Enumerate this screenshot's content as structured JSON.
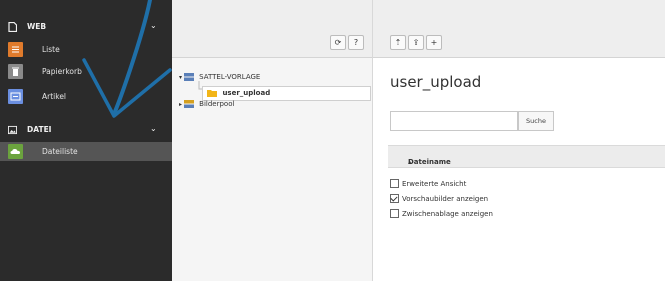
{
  "sidebar": {
    "groups": [
      {
        "label": "WEB",
        "icon": "page-icon",
        "items": [
          {
            "label": "Liste",
            "icon": "list-module-icon",
            "color": "#e07b2c"
          },
          {
            "label": "Papierkorb",
            "icon": "trash-module-icon",
            "color": "#8a8a8a"
          },
          {
            "label": "Artikel",
            "icon": "article-module-icon",
            "color": "#6b8fe0"
          }
        ]
      },
      {
        "label": "DATEI",
        "icon": "image-icon",
        "items": [
          {
            "label": "Dateiliste",
            "icon": "cloud-module-icon",
            "color": "#6ba33e",
            "active": true
          }
        ]
      }
    ],
    "chevron": "⌄"
  },
  "tree": {
    "toolbar": {
      "refresh_icon": "⟳",
      "help_label": "?"
    },
    "nodes": [
      {
        "label": "SATTEL-VORLAGE",
        "icon": "storage-icon",
        "expanded": true
      },
      {
        "label": "user_upload",
        "icon": "folder-icon",
        "selected": true
      },
      {
        "label": "Bilderpool",
        "icon": "storage-icon",
        "expanded": false
      }
    ]
  },
  "content": {
    "toolbar": {
      "upload_icon": "⇡",
      "new_file_icon": "⇪",
      "new_folder_label": "+"
    },
    "title": "user_upload",
    "search": {
      "value": "",
      "button_label": "Suche"
    },
    "table": {
      "column_header": "Dateiname",
      "sort_indicator": "▴"
    },
    "options": [
      {
        "label": "Erweiterte Ansicht",
        "checked": false
      },
      {
        "label": "Vorschaubilder anzeigen",
        "checked": true
      },
      {
        "label": "Zwischenablage anzeigen",
        "checked": false
      }
    ]
  },
  "colors": {
    "sidebar_bg": "#2b2b2b",
    "annotation_arrow": "#1f6fa8",
    "folder": "#f2b518"
  }
}
